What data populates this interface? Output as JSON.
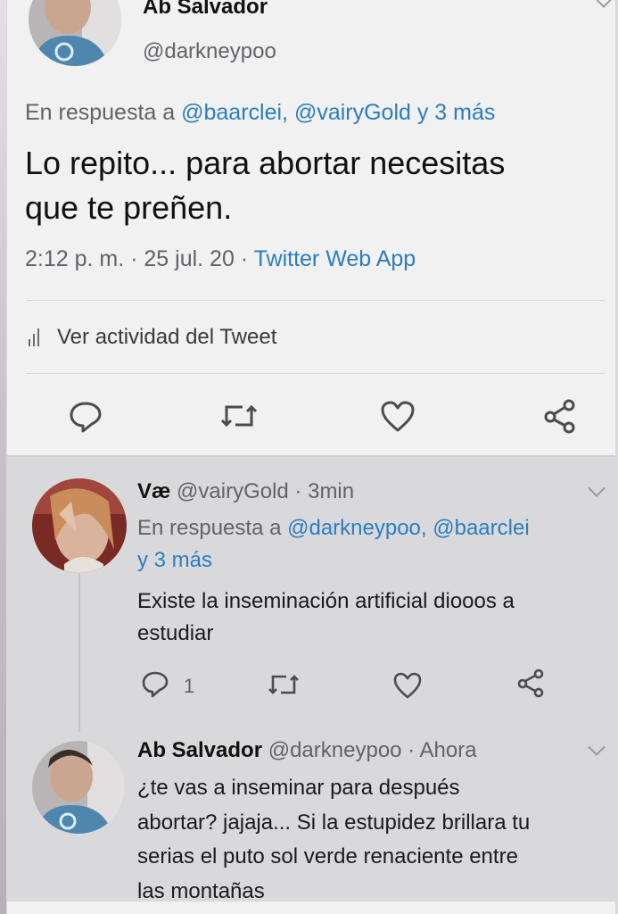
{
  "main_tweet": {
    "name": "Ab Salvador",
    "handle": "@darkneypoo",
    "reply_prefix": "En respuesta a",
    "reply_to": "@baarclei, @vairyGold y 3 más",
    "text_line1": "Lo repito...  para abortar necesitas",
    "text_line2": "que te preñen.",
    "time_date": "2:12 p. m. · 25 jul. 20 ·",
    "source": "Twitter Web App",
    "activity_label": "Ver actividad del Tweet"
  },
  "replies": [
    {
      "name": "Væ",
      "handle_time": "@vairyGold · 3min",
      "reply_prefix": "En respuesta a",
      "reply_to_line1": "@darkneypoo, @baarclei",
      "reply_to_line2": "y 3 más",
      "text_line1": "Existe la inseminación artificial diooos a",
      "text_line2": "estudiar",
      "reply_count": "1"
    },
    {
      "name": "Ab Salvador",
      "handle_time": "@darkneypoo · Ahora",
      "text_line1": "¿te vas a inseminar para después",
      "text_line2": "abortar? jajaja... Si la estupidez brillara tu",
      "text_line3": "serias el puto sol verde renaciente entre",
      "text_line4": "las montañas"
    }
  ],
  "icons": [
    "reply-icon",
    "retweet-icon",
    "like-icon",
    "share-icon",
    "bar-chart-icon",
    "chevron-down-icon"
  ],
  "colors": {
    "link": "#2b7dc0",
    "text": "#111111",
    "secondary": "#5f6368",
    "background": "#f1f1f2"
  }
}
